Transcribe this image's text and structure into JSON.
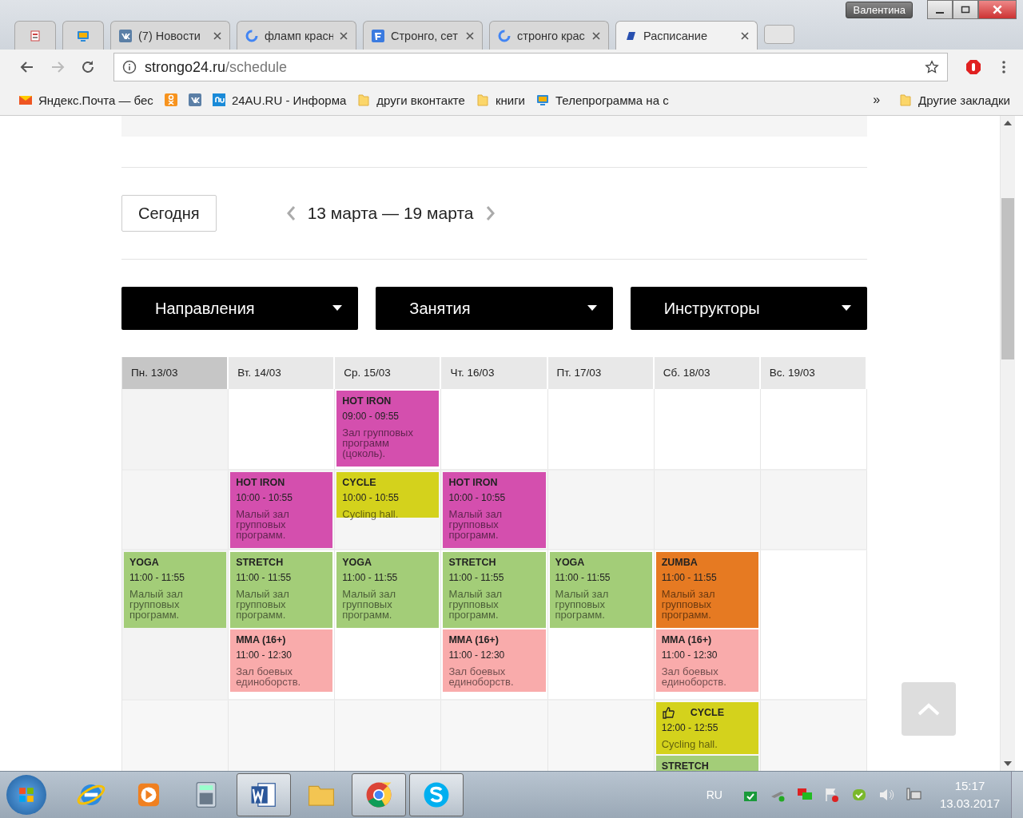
{
  "profile": "Валентина",
  "tabs": [
    {
      "selected": false
    },
    {
      "selected": false
    },
    {
      "title": "(7) Новости",
      "selected": false
    },
    {
      "title": "фламп красн",
      "selected": false
    },
    {
      "title": "Стронго, сет",
      "selected": false
    },
    {
      "title": "стронго крас",
      "selected": false
    },
    {
      "title": "Расписание",
      "selected": true
    }
  ],
  "address": {
    "host": "strongo24.ru",
    "path": "/schedule"
  },
  "bookmarks": [
    "Яндекс.Почта — бес",
    "24AU.RU - Информа",
    "други вконтакте",
    "книги",
    "Телепрограмма на с"
  ],
  "bookmarks_more": "»",
  "other_bookmarks": "Другие закладки",
  "today_button": "Сегодня",
  "week_range": "13 марта — 19 марта",
  "filters": [
    "Направления",
    "Занятия",
    "Инструкторы"
  ],
  "days": [
    {
      "label": "Пн. 13/03",
      "selected": true
    },
    {
      "label": "Вт. 14/03",
      "selected": false
    },
    {
      "label": "Ср. 15/03",
      "selected": false
    },
    {
      "label": "Чт. 16/03",
      "selected": false
    },
    {
      "label": "Пт. 17/03",
      "selected": false
    },
    {
      "label": "Сб. 18/03",
      "selected": false
    },
    {
      "label": "Вс. 19/03",
      "selected": false
    }
  ],
  "rows": [
    [
      [],
      [],
      [
        {
          "name": "HOT IRON",
          "time": "09:00 - 09:55",
          "room": "Зал групповых программ (цоколь).",
          "color": "#d44fae",
          "liked": false
        }
      ],
      [],
      [],
      [],
      []
    ],
    [
      [],
      [
        {
          "name": "HOT IRON",
          "time": "10:00 - 10:55",
          "room": "Малый зал групповых программ.",
          "color": "#d44fae",
          "liked": false
        }
      ],
      [
        {
          "name": "CYCLE",
          "time": "10:00 - 10:55",
          "room": "Cycling hall.",
          "color": "#d4d21c",
          "liked": false
        }
      ],
      [
        {
          "name": "HOT IRON",
          "time": "10:00 - 10:55",
          "room": "Малый зал групповых программ.",
          "color": "#d44fae",
          "liked": false
        }
      ],
      [],
      [],
      []
    ],
    [
      [
        {
          "name": "YOGA",
          "time": "11:00 - 11:55",
          "room": "Малый зал групповых программ.",
          "color": "#a3cd78",
          "liked": false
        }
      ],
      [
        {
          "name": "STRETCH",
          "time": "11:00 - 11:55",
          "room": "Малый зал групповых программ.",
          "color": "#a3cd78",
          "liked": false
        },
        {
          "name": "MMA (16+)",
          "time": "11:00 - 12:30",
          "room": "Зал боевых единоборств.",
          "color": "#f9abab",
          "liked": false
        }
      ],
      [
        {
          "name": "YOGA",
          "time": "11:00 - 11:55",
          "room": "Малый зал групповых программ.",
          "color": "#a3cd78",
          "liked": false
        }
      ],
      [
        {
          "name": "STRETCH",
          "time": "11:00 - 11:55",
          "room": "Малый зал групповых программ.",
          "color": "#a3cd78",
          "liked": false
        },
        {
          "name": "MMA (16+)",
          "time": "11:00 - 12:30",
          "room": "Зал боевых единоборств.",
          "color": "#f9abab",
          "liked": false
        }
      ],
      [
        {
          "name": "YOGA",
          "time": "11:00 - 11:55",
          "room": "Малый зал групповых программ.",
          "color": "#a3cd78",
          "liked": false
        }
      ],
      [
        {
          "name": "ZUMBA",
          "time": "11:00 - 11:55",
          "room": "Малый зал групповых программ.",
          "color": "#e67a22",
          "liked": false
        },
        {
          "name": "MMA (16+)",
          "time": "11:00 - 12:30",
          "room": "Зал боевых единоборств.",
          "color": "#f9abab",
          "liked": false
        }
      ],
      []
    ],
    [
      [],
      [],
      [],
      [],
      [],
      [
        {
          "name": "CYCLE",
          "time": "12:00 - 12:55",
          "room": "Cycling hall.",
          "color": "#d4d21c",
          "liked": true
        },
        {
          "name": "STRETCH",
          "color": "#a3cd78",
          "liked": false
        }
      ],
      []
    ]
  ],
  "taskbar": [
    {
      "active": false
    },
    {
      "active": false
    },
    {
      "active": false
    },
    {
      "active": true
    },
    {
      "active": false
    },
    {
      "active": true
    },
    {
      "active": true
    }
  ],
  "tray": {
    "language": "RU",
    "time": "15:17",
    "date": "13.03.2017"
  }
}
